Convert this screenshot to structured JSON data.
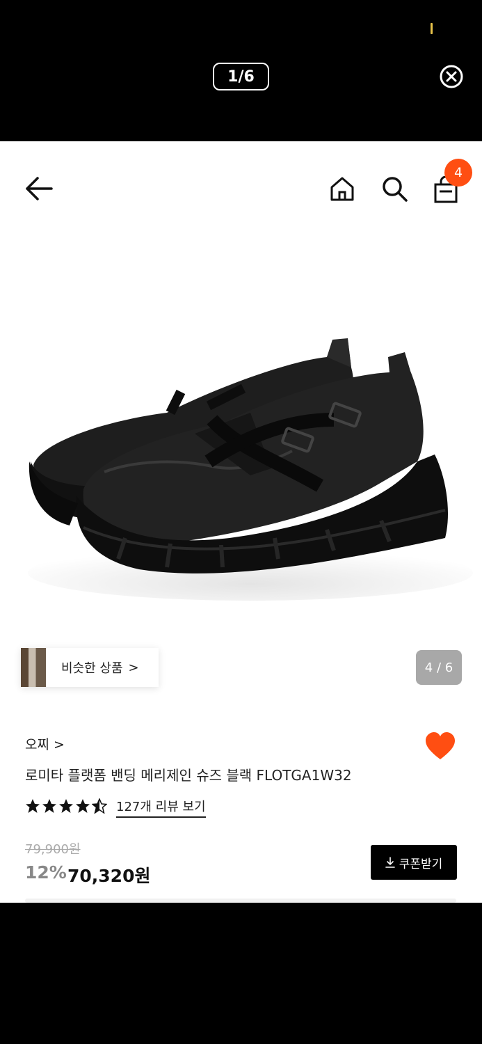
{
  "viewer": {
    "page_indicator": "1/6",
    "close_icon": "close-circle-icon"
  },
  "nav": {
    "back_icon": "arrow-left-icon",
    "home_icon": "home-icon",
    "search_icon": "search-icon",
    "cart_icon": "shopping-bag-icon",
    "cart_count": "4"
  },
  "gallery": {
    "similar_label": "비슷한 상품",
    "similar_chevron": ">",
    "counter": "4 / 6"
  },
  "product": {
    "brand": "오찌 >",
    "title": "로미타 플랫폼 밴딩 메리제인 슈즈 블랙 FLOTGA1W32",
    "rating": 4.5,
    "review_link": "127개 리뷰 보기",
    "original_price": "79,900원",
    "discount": "12%",
    "sale_price": "70,320원",
    "coupon_label": "쿠폰받기",
    "wish_color": "#ff4e12"
  },
  "colors": {
    "accent": "#ff4e12",
    "black": "#000000"
  }
}
